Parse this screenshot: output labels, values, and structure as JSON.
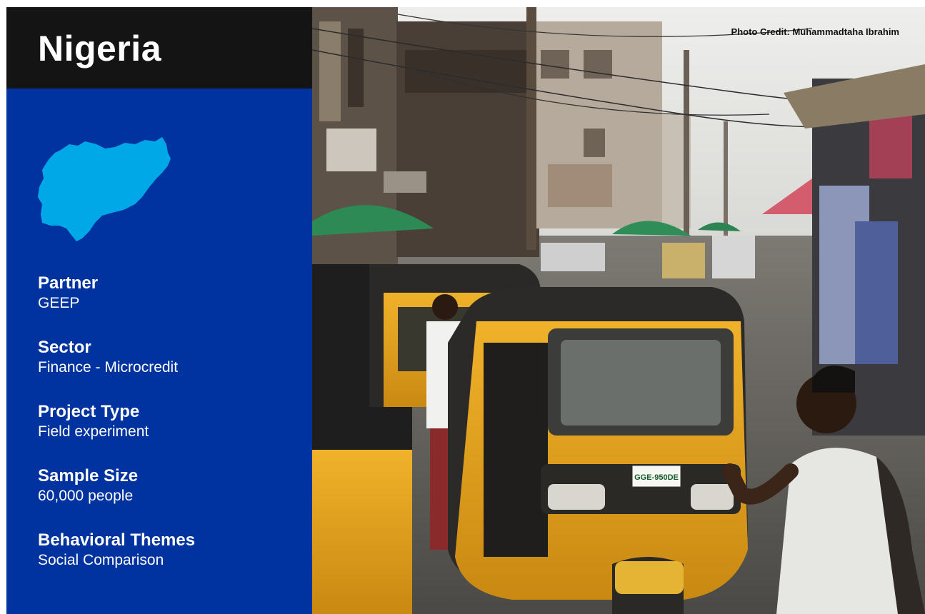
{
  "header": {
    "country": "Nigeria"
  },
  "map": {
    "icon": "nigeria-map-icon",
    "color": "#00a8e8"
  },
  "info": [
    {
      "label": "Partner",
      "value": "GEEP"
    },
    {
      "label": "Sector",
      "value": "Finance - Microcredit"
    },
    {
      "label": "Project Type",
      "value": "Field experiment"
    },
    {
      "label": "Sample Size",
      "value": "60,000 people"
    },
    {
      "label": "Behavioral Themes",
      "value": "Social Comparison"
    }
  ],
  "photo": {
    "credit": "Photo Credit: Muhammadtaha Ibrahim",
    "plate": "GGE-950DE"
  },
  "colors": {
    "panel": "#0033a0",
    "title_bar": "#141414",
    "text": "#ffffff",
    "tricycle": "#e8a41c"
  }
}
